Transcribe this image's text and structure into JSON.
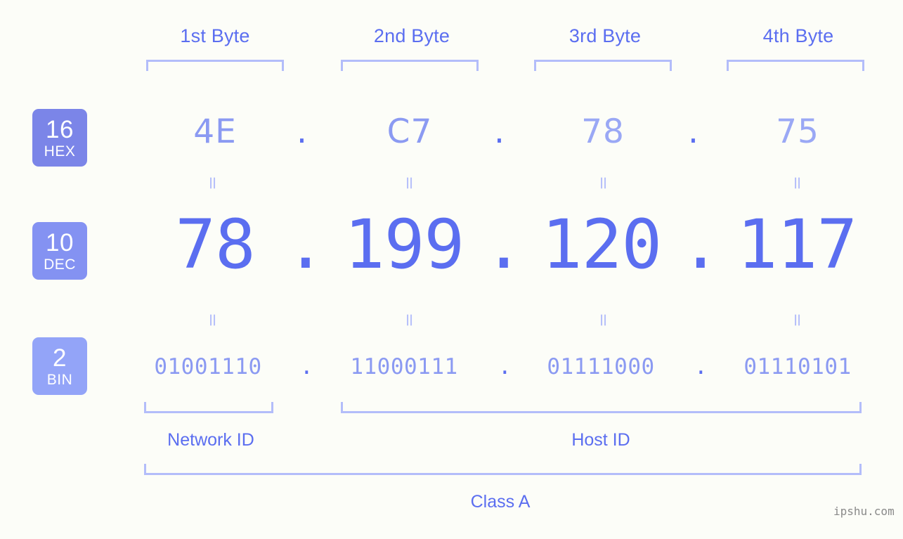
{
  "diagram": {
    "ip_address": "78.199.120.117",
    "byte_headers": [
      {
        "label": "1st Byte"
      },
      {
        "label": "2nd Byte"
      },
      {
        "label": "3rd Byte"
      },
      {
        "label": "4th Byte"
      }
    ],
    "rows": [
      {
        "badge_number": "16",
        "badge_label": "HEX",
        "badge_color": "#7b85e8",
        "values": [
          "4E",
          "C7",
          "78",
          "75"
        ]
      },
      {
        "badge_number": "10",
        "badge_label": "DEC",
        "badge_color": "#8492f2",
        "values": [
          "78",
          "199",
          "120",
          "117"
        ]
      },
      {
        "badge_number": "2",
        "badge_label": "BIN",
        "badge_color": "#93a4f8",
        "values": [
          "01001110",
          "11000111",
          "01111000",
          "01110101"
        ]
      }
    ],
    "separator": ".",
    "equals_mark": "=",
    "network_id_label": "Network ID",
    "host_id_label": "Host ID",
    "class_label": "Class A",
    "watermark": "ipshu.com",
    "accent_color": "#5b6ef0",
    "bracket_color": "#b3bdfa",
    "background_color": "#fcfdf8"
  }
}
